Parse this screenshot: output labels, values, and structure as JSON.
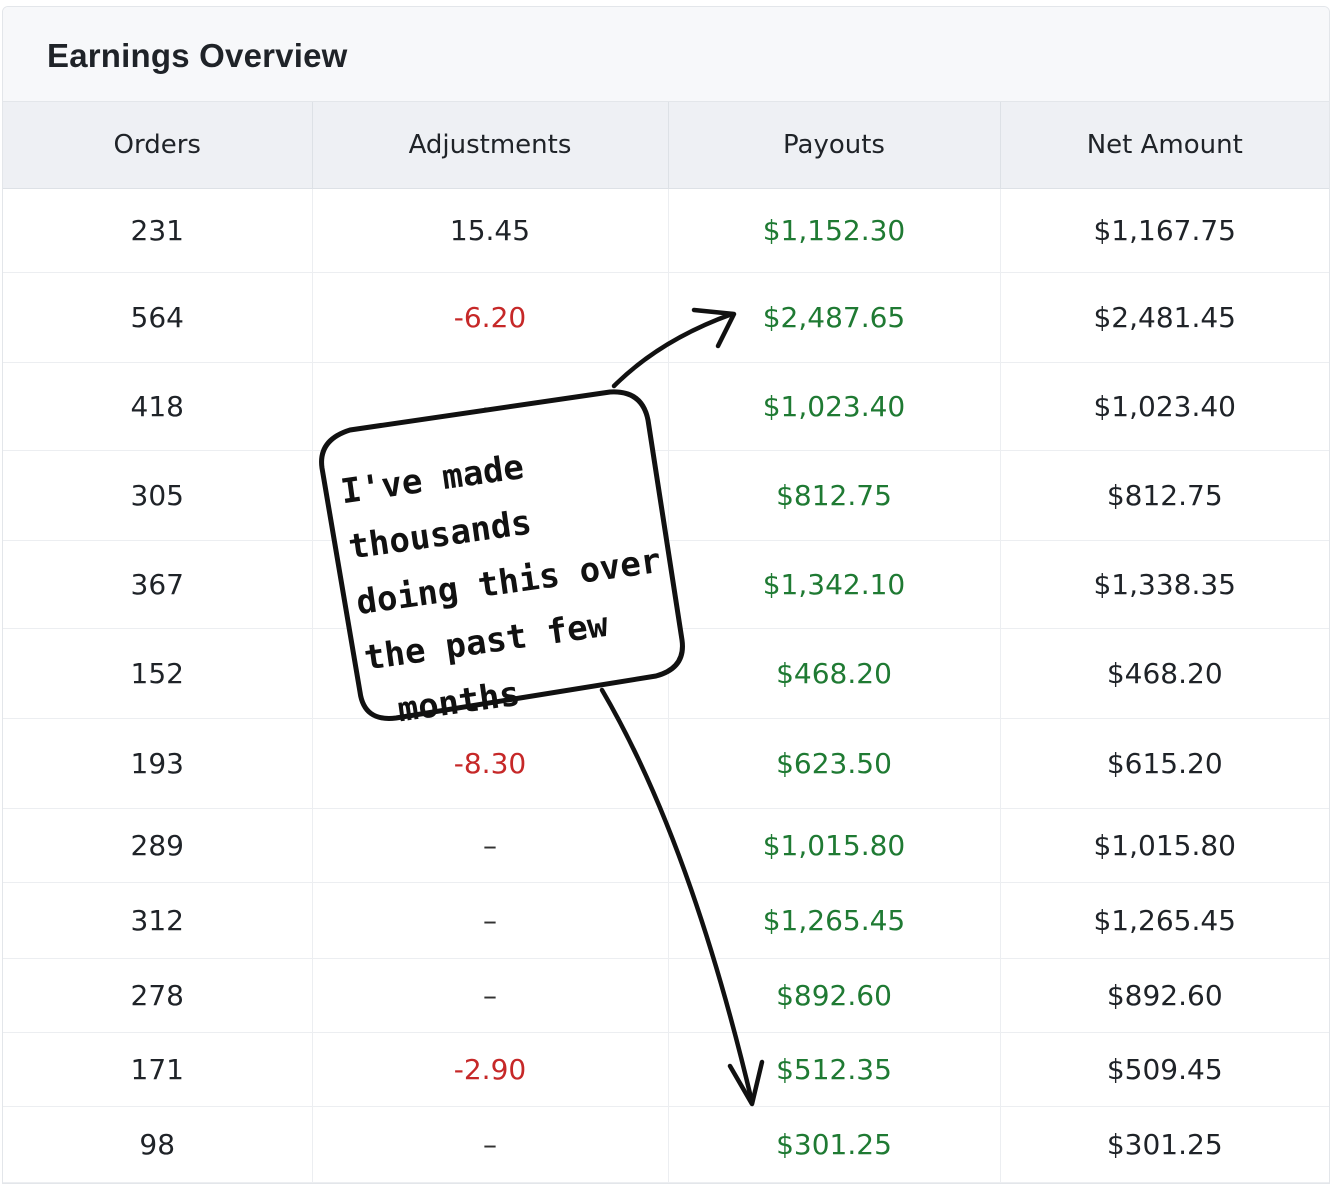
{
  "header": {
    "title": "Earnings Overview"
  },
  "table": {
    "columns": [
      "Orders",
      "Adjustments",
      "Payouts",
      "Net Amount"
    ],
    "rows": [
      {
        "orders": "231",
        "adjustments": "15.45",
        "adj_kind": "plain",
        "payouts": "$1,152.30",
        "net": "$1,167.75"
      },
      {
        "orders": "564",
        "adjustments": "-6.20",
        "adj_kind": "neg",
        "payouts": "$2,487.65",
        "net": "$2,481.45"
      },
      {
        "orders": "418",
        "adjustments": "–",
        "adj_kind": "dash",
        "payouts": "$1,023.40",
        "net": "$1,023.40"
      },
      {
        "orders": "305",
        "adjustments": "",
        "adj_kind": "plain",
        "payouts": "$812.75",
        "net": "$812.75"
      },
      {
        "orders": "367",
        "adjustments": "",
        "adj_kind": "plain",
        "payouts": "$1,342.10",
        "net": "$1,338.35"
      },
      {
        "orders": "152",
        "adjustments": "",
        "adj_kind": "plain",
        "payouts": "$468.20",
        "net": "$468.20"
      },
      {
        "orders": "193",
        "adjustments": "-8.30",
        "adj_kind": "neg",
        "payouts": "$623.50",
        "net": "$615.20"
      },
      {
        "orders": "289",
        "adjustments": "–",
        "adj_kind": "dash",
        "payouts": "$1,015.80",
        "net": "$1,015.80"
      },
      {
        "orders": "312",
        "adjustments": "–",
        "adj_kind": "dash",
        "payouts": "$1,265.45",
        "net": "$1,265.45"
      },
      {
        "orders": "278",
        "adjustments": "–",
        "adj_kind": "dash",
        "payouts": "$892.60",
        "net": "$892.60"
      },
      {
        "orders": "171",
        "adjustments": "-2.90",
        "adj_kind": "neg",
        "payouts": "$512.35",
        "net": "$509.45"
      },
      {
        "orders": "98",
        "adjustments": "–",
        "adj_kind": "dash",
        "payouts": "$301.25",
        "net": "$301.25"
      }
    ]
  },
  "annotation": {
    "lines": [
      "I've made",
      "thousands",
      "doing this over",
      "the past few",
      "months"
    ]
  },
  "colors": {
    "positive": "#1f7a33",
    "negative": "#c62828",
    "header_bg": "#eef0f4"
  }
}
